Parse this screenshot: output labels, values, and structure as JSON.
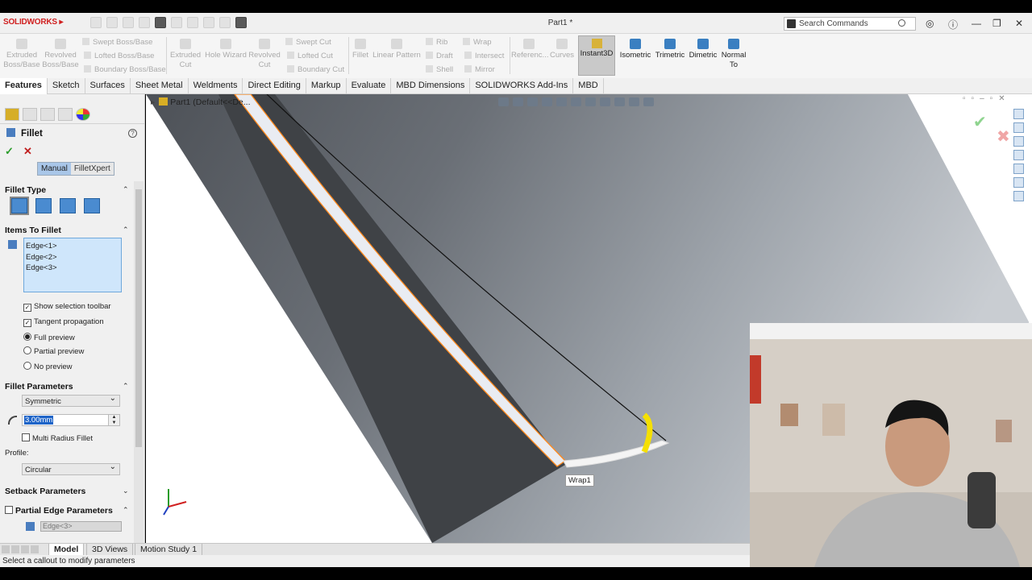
{
  "app": {
    "logo_text": "SOLIDWORKS",
    "document_title": "Part1 *",
    "search_placeholder": "Search Commands"
  },
  "ribbon": {
    "buttons": [
      {
        "label": "Extruded Boss/Base"
      },
      {
        "label": "Revolved Boss/Base"
      },
      {
        "label": "Swept Boss/Base"
      },
      {
        "label": "Lofted Boss/Base"
      },
      {
        "label": "Boundary Boss/Base"
      },
      {
        "label": "Extruded Cut"
      },
      {
        "label": "Hole Wizard"
      },
      {
        "label": "Revolved Cut"
      },
      {
        "label": "Swept Cut"
      },
      {
        "label": "Lofted Cut"
      },
      {
        "label": "Boundary Cut"
      },
      {
        "label": "Fillet"
      },
      {
        "label": "Linear Pattern"
      },
      {
        "label": "Rib"
      },
      {
        "label": "Draft"
      },
      {
        "label": "Shell"
      },
      {
        "label": "Wrap"
      },
      {
        "label": "Intersect"
      },
      {
        "label": "Mirror"
      },
      {
        "label": "Referenc..."
      },
      {
        "label": "Curves"
      },
      {
        "label": "Instant3D"
      },
      {
        "label": "Isometric"
      },
      {
        "label": "Trimetric"
      },
      {
        "label": "Dimetric"
      },
      {
        "label": "Normal To"
      }
    ]
  },
  "command_tabs": [
    "Features",
    "Sketch",
    "Surfaces",
    "Sheet Metal",
    "Weldments",
    "Direct Editing",
    "Markup",
    "Evaluate",
    "MBD Dimensions",
    "SOLIDWORKS Add-Ins",
    "MBD"
  ],
  "property_manager": {
    "title": "Fillet",
    "help": "?",
    "ok": "✓",
    "cancel": "✕",
    "mode_manual": "Manual",
    "mode_expert": "FilletXpert",
    "fillet_type_header": "Fillet Type",
    "items_header": "Items To Fillet",
    "edges": [
      "Edge<1>",
      "Edge<2>",
      "Edge<3>"
    ],
    "show_selection_toolbar": "Show selection toolbar",
    "tangent_propagation": "Tangent propagation",
    "full_preview": "Full preview",
    "partial_preview": "Partial preview",
    "no_preview": "No preview",
    "params_header": "Fillet Parameters",
    "symmetric": "Symmetric",
    "radius": "3.00mm",
    "multi_radius": "Multi Radius Fillet",
    "profile_label": "Profile:",
    "profile_value": "Circular",
    "setback_header": "Setback Parameters",
    "partial_edge_header": "Partial Edge Parameters",
    "partial_edge_value": "Edge<3>"
  },
  "viewport": {
    "tree_item": "Part1  (Default<<De...",
    "tooltip": "Wrap1"
  },
  "bottom_tabs": [
    "Model",
    "3D Views",
    "Motion Study 1"
  ],
  "status_text": "Select a callout to modify parameters"
}
